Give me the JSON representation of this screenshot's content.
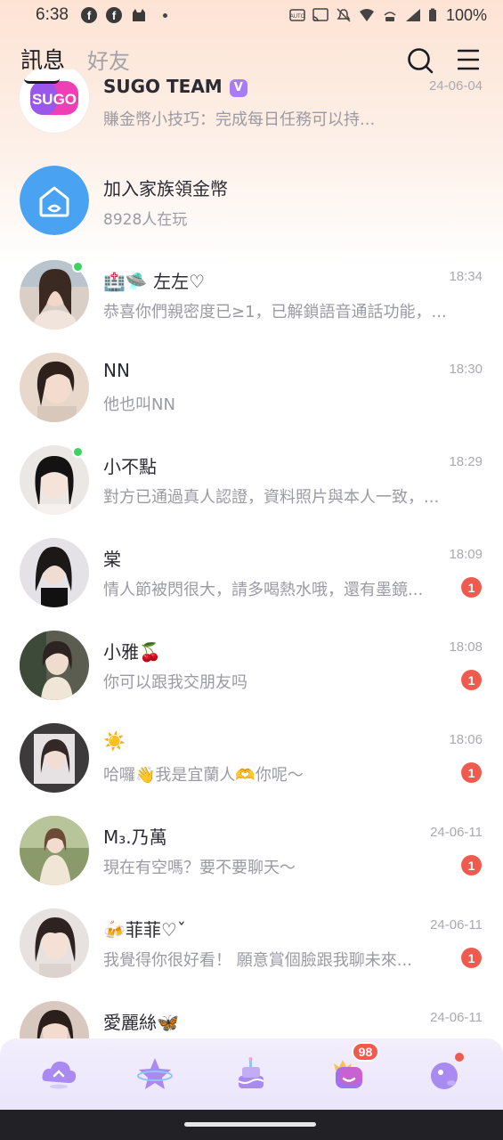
{
  "status_bar": {
    "time": "6:38",
    "battery": "100%",
    "left_icons": [
      "facebook-icon",
      "facebook-icon",
      "cat-app-icon",
      "dot-icon"
    ],
    "right_icons": [
      "nfc-icon",
      "cast-icon",
      "mute-icon",
      "wifi-icon",
      "volte-icon",
      "signal-icon"
    ]
  },
  "nav": {
    "tab_messages": "訊息",
    "tab_friends": "好友",
    "search_icon": "search-icon",
    "menu_icon": "menu-icon"
  },
  "conversations": [
    {
      "name": "SUGO TEAM",
      "preview": "賺金幣小技巧：完成每日任務可以持...",
      "time": "24-06-04",
      "unread": "",
      "online": false,
      "verified": "V",
      "avatar": "sugo-logo"
    },
    {
      "name": "加入家族領金幣",
      "preview": "8928人在玩",
      "time": "",
      "unread": "",
      "online": false,
      "avatar": "family-house-icon"
    },
    {
      "name": "🏥🛸 左左♡",
      "preview": "恭喜你們親密度已≥1，已解鎖語音通話功能，...",
      "time": "18:34",
      "unread": "",
      "online": true,
      "avatar": "photo"
    },
    {
      "name": "NN",
      "preview": "他也叫NN",
      "time": "18:30",
      "unread": "",
      "online": false,
      "avatar": "photo"
    },
    {
      "name": "小不點",
      "preview": "對方已通過真人認證，資料照片與本人一致，...",
      "time": "18:29",
      "unread": "",
      "online": true,
      "avatar": "photo"
    },
    {
      "name": "棠",
      "preview": "情人節被閃很大，請多喝熱水哦，還有墨鏡...",
      "time": "18:09",
      "unread": "1",
      "online": false,
      "avatar": "photo"
    },
    {
      "name": "小雅🍒",
      "preview": "你可以跟我交朋友吗",
      "time": "18:08",
      "unread": "1",
      "online": false,
      "avatar": "photo"
    },
    {
      "name": "☀️",
      "preview": "哈囉👋我是宜蘭人🫶你呢〜",
      "time": "18:06",
      "unread": "1",
      "online": false,
      "avatar": "photo"
    },
    {
      "name": "M₃.乃萬",
      "preview": "現在有空嗎？要不要聊天〜",
      "time": "24-06-11",
      "unread": "1",
      "online": false,
      "avatar": "photo"
    },
    {
      "name": "🍻菲菲♡ˇ",
      "preview": "我覺得你很好看！ 願意賞個臉跟我聊未來...",
      "time": "24-06-11",
      "unread": "1",
      "online": false,
      "avatar": "photo"
    },
    {
      "name": "愛麗絲🦋",
      "preview": "",
      "time": "24-06-11",
      "unread": "",
      "online": false,
      "avatar": "photo"
    }
  ],
  "bottom_nav": {
    "items": [
      "home-cloud-icon",
      "star-planet-icon",
      "cake-icon",
      "messages-crown-icon",
      "profile-blob-icon"
    ],
    "messages_badge": "98"
  },
  "colors": {
    "accent_red": "#f05b4f",
    "online_green": "#3cd461",
    "purple": "#a77cf5"
  }
}
